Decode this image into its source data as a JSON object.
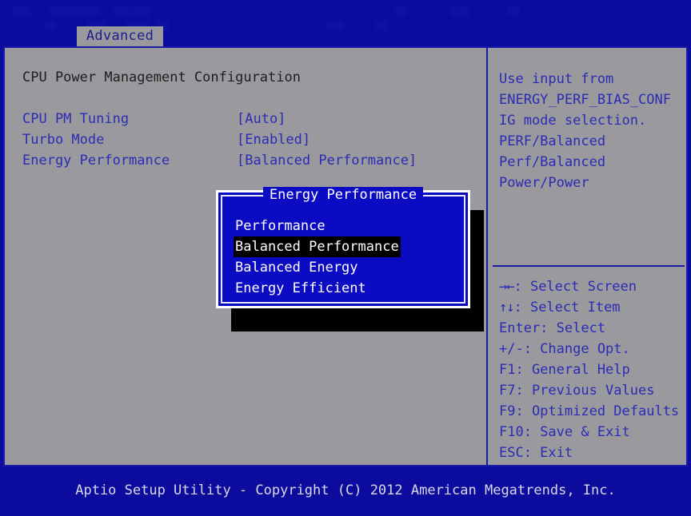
{
  "colors": {
    "screen_blue": "#0b0b9e",
    "panel_gray": "#9a9a9e",
    "frame_border_blue": "#1a1aa8",
    "text_blue": "#2b2bb4",
    "text_dark": "#1e1e1e",
    "dialog_blue": "#0b0bc4",
    "dialog_border_white": "#ffffff",
    "highlight_black": "#000000",
    "highlight_text": "#ffffff",
    "footer_text": "#d8d8e8",
    "tab_bg": "#9a9a9e",
    "tab_text": "#1c1c8e"
  },
  "menubar": {
    "ghost_row_top": "  ▒▒▒   ▒▒▒▒▒▒▒▒  ▒▒▒▒▒▒                                       ▒▒       ▒▒▒      ▒▒   ",
    "ghost_row_mid": "       ▒▒     ▒▒▒   ▒▒▒▒ ▒▒                         ▒▒▒     ▒▒   ",
    "tabs": [
      {
        "label": "Advanced",
        "active": true
      }
    ]
  },
  "main": {
    "section_title": "CPU Power Management Configuration",
    "settings": [
      {
        "label": "CPU PM Tuning",
        "value": "[Auto]"
      },
      {
        "label": "Turbo Mode",
        "value": "[Enabled]"
      },
      {
        "label": "Energy Performance",
        "value": "[Balanced Performance]"
      }
    ]
  },
  "dialog": {
    "title": "Energy Performance",
    "options": [
      {
        "label": "Performance",
        "selected": false
      },
      {
        "label": "Balanced Performance",
        "selected": true
      },
      {
        "label": "Balanced Energy",
        "selected": false
      },
      {
        "label": "Energy Efficient",
        "selected": false
      }
    ]
  },
  "help": {
    "description_lines": [
      "Use input from",
      "ENERGY_PERF_BIAS_CONF",
      "IG mode selection.",
      "PERF/Balanced",
      "Perf/Balanced",
      "Power/Power"
    ],
    "keys": [
      {
        "glyph": "→←",
        "text": ": Select Screen"
      },
      {
        "glyph": "↑↓",
        "text": ": Select Item"
      },
      {
        "glyph": "",
        "text": "Enter: Select"
      },
      {
        "glyph": "",
        "text": "+/-: Change Opt."
      },
      {
        "glyph": "",
        "text": "F1: General Help"
      },
      {
        "glyph": "",
        "text": "F7: Previous Values"
      },
      {
        "glyph": "",
        "text": "F9: Optimized Defaults"
      },
      {
        "glyph": "",
        "text": "F10: Save & Exit"
      },
      {
        "glyph": "",
        "text": "ESC: Exit"
      }
    ]
  },
  "footer": {
    "text": "Aptio Setup Utility - Copyright (C) 2012 American Megatrends, Inc."
  }
}
